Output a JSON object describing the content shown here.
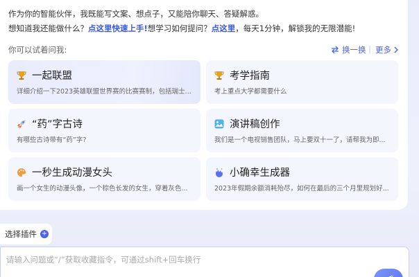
{
  "intro": {
    "line1": "作为你的智能伙伴，我既能写文案、想点子，又能陪你聊天、答疑解惑。",
    "line2_a": "想知道我还能做什么？",
    "line2_link1": "点这里快速上手!",
    "line2_b": "想学习如何提问？",
    "line2_link2": "点这里",
    "line2_c": "，每天1分钟，解锁我的无限潜能!"
  },
  "suggestions": {
    "label": "你可以试着问我:",
    "swap_label": "换一换",
    "more_label": "更多",
    "items": [
      {
        "title": "一起联盟",
        "desc": "详细介绍一下2023英雄联盟世界赛的比赛赛制，包括瑞士...",
        "icon": "trophy-icon"
      },
      {
        "title": "考学指南",
        "desc": "考上重点大学都需要什么",
        "icon": "trophy-icon"
      },
      {
        "title": "“药”字古诗",
        "desc": "有哪些古诗带有“药”字?",
        "icon": "rocket-icon"
      },
      {
        "title": "演讲稿创作",
        "desc": "我们是一个电视销售团队，马上要双十一了，请帮我为即...",
        "icon": "image-icon"
      },
      {
        "title": "一秒生成动漫女头",
        "desc": "画一个女生的动漫头像，一个棕色长发的女生，穿着灰色...",
        "icon": "palette-icon"
      },
      {
        "title": "小确幸生成器",
        "desc": "2023年假期余额消耗殆尽，如何在最后的三个月里规划好...",
        "icon": "sparkle-icon"
      }
    ]
  },
  "plugin": {
    "label": "选择插件",
    "icon": "plus-icon"
  },
  "composer": {
    "placeholder": "请输入问题或“/”获取收藏指令，可通过shift+回车换行",
    "send_icon": "send-icon"
  },
  "colors": {
    "accent": "#4b63ea",
    "card_bg": "#f4f6fd",
    "page_bg": "#e9edfb"
  }
}
